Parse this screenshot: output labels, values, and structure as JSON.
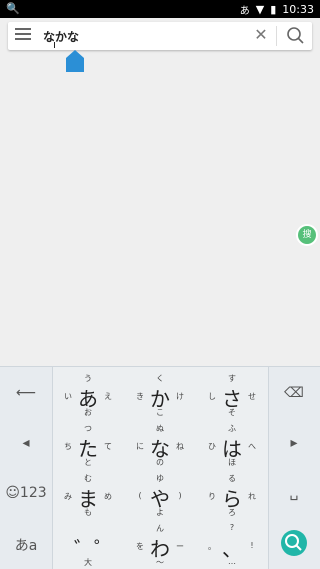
{
  "status": {
    "ime": "あ",
    "time": "10:33"
  },
  "search": {
    "query": "なかな"
  },
  "badge": {
    "label": "搜"
  },
  "keyboard": {
    "left": [
      {
        "name": "undo-key",
        "glyph": "⟵"
      },
      {
        "name": "cursor-left-key",
        "glyph": "◂"
      },
      {
        "name": "emoji-key",
        "glyph": "☺123"
      },
      {
        "name": "mode-switch-key",
        "glyph": "あa"
      }
    ],
    "right": [
      {
        "name": "backspace-key",
        "glyph": "⌫"
      },
      {
        "name": "cursor-right-key",
        "glyph": "▸"
      },
      {
        "name": "space-key",
        "glyph": "␣"
      }
    ],
    "kana": [
      {
        "name": "key-a",
        "c": "あ",
        "u": "う",
        "l": "い",
        "r": "え",
        "d": "お"
      },
      {
        "name": "key-ka",
        "c": "か",
        "u": "く",
        "l": "き",
        "r": "け",
        "d": "こ"
      },
      {
        "name": "key-sa",
        "c": "さ",
        "u": "す",
        "l": "し",
        "r": "せ",
        "d": "そ"
      },
      {
        "name": "key-ta",
        "c": "た",
        "u": "つ",
        "l": "ち",
        "r": "て",
        "d": "と"
      },
      {
        "name": "key-na",
        "c": "な",
        "u": "ぬ",
        "l": "に",
        "r": "ね",
        "d": "の"
      },
      {
        "name": "key-ha",
        "c": "は",
        "u": "ふ",
        "l": "ひ",
        "r": "へ",
        "d": "ほ"
      },
      {
        "name": "key-ma",
        "c": "ま",
        "u": "む",
        "l": "み",
        "r": "め",
        "d": "も"
      },
      {
        "name": "key-ya",
        "c": "や",
        "u": "ゆ",
        "l": "(",
        "r": ")",
        "d": "よ"
      },
      {
        "name": "key-ra",
        "c": "ら",
        "u": "る",
        "l": "り",
        "r": "れ",
        "d": "ろ"
      },
      {
        "name": "key-dakuten",
        "c": "゛゜",
        "u": "",
        "l": "",
        "r": "",
        "d": "大⇔小"
      },
      {
        "name": "key-wa",
        "c": "わ",
        "u": "ん",
        "l": "を",
        "r": "ー",
        "d": "〜"
      },
      {
        "name": "key-punct",
        "c": "、",
        "u": "?",
        "l": "。",
        "r": "!",
        "d": "…"
      }
    ]
  }
}
